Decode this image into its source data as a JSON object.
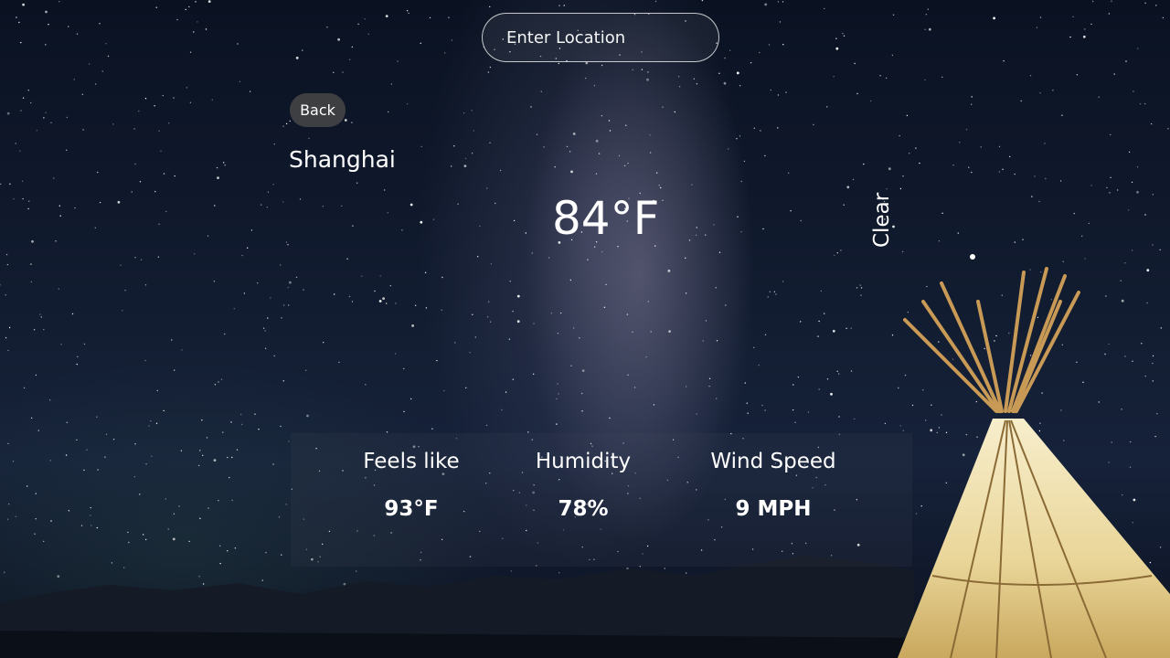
{
  "search": {
    "placeholder": "Enter Location",
    "value": ""
  },
  "nav": {
    "back_label": "Back"
  },
  "weather": {
    "city": "Shanghai",
    "temperature": "84°F",
    "condition": "Clear"
  },
  "details": [
    {
      "label": "Feels like",
      "value": "93°F"
    },
    {
      "label": "Humidity",
      "value": "78%"
    },
    {
      "label": "Wind Speed",
      "value": "9 MPH"
    }
  ],
  "colors": {
    "sky_top": "#0a1222",
    "sky_mid": "#16223a",
    "text": "#ffffff",
    "back_button_bg": "#464646",
    "teepee_glow": "#f3e3b0"
  }
}
